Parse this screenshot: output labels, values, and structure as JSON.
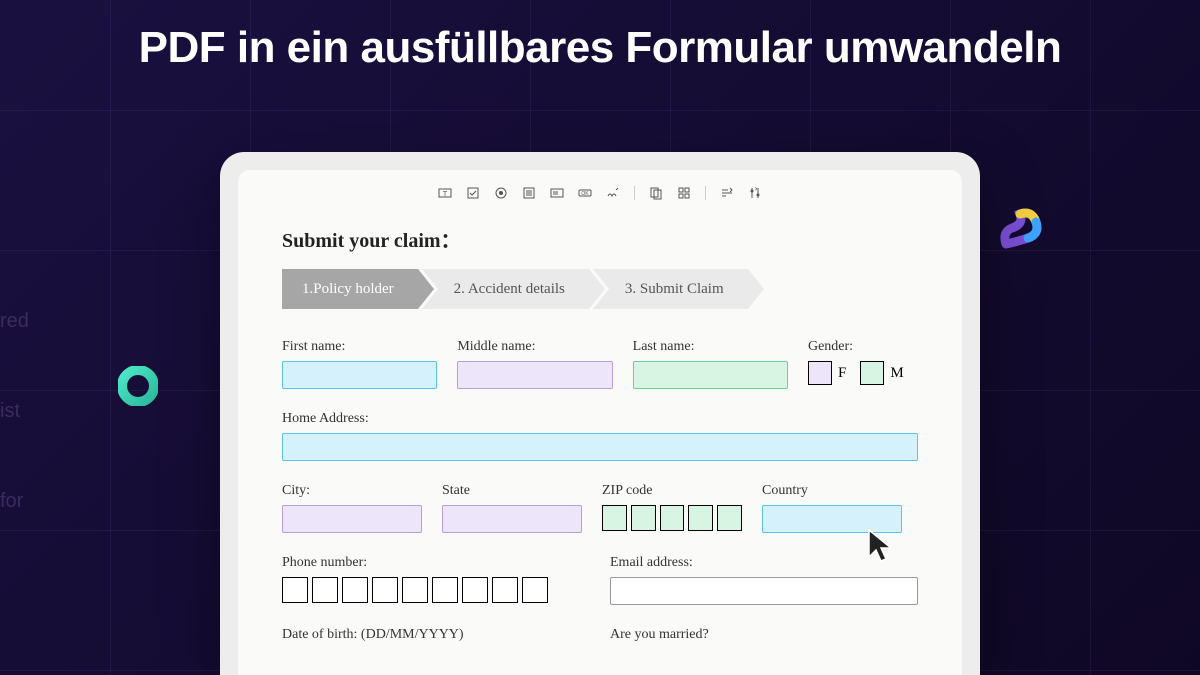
{
  "headline": "PDF in ein ausfüllbares Formular umwandeln",
  "bg_text": {
    "t1": "red",
    "t2": "ist",
    "t3": "for"
  },
  "form": {
    "title": "Submit your claim：",
    "steps": [
      "1.Policy holder",
      "2. Accident details",
      "3. Submit Claim"
    ],
    "labels": {
      "first_name": "First name:",
      "middle_name": "Middle name:",
      "last_name": "Last name:",
      "gender": "Gender:",
      "gender_f": "F",
      "gender_m": "M",
      "home_address": "Home Address:",
      "city": "City:",
      "state": "State",
      "zip": "ZIP code",
      "country": "Country",
      "phone": "Phone number:",
      "email": "Email address:",
      "dob": "Date of birth: (DD/MM/YYYY)",
      "married": "Are you married?"
    }
  }
}
